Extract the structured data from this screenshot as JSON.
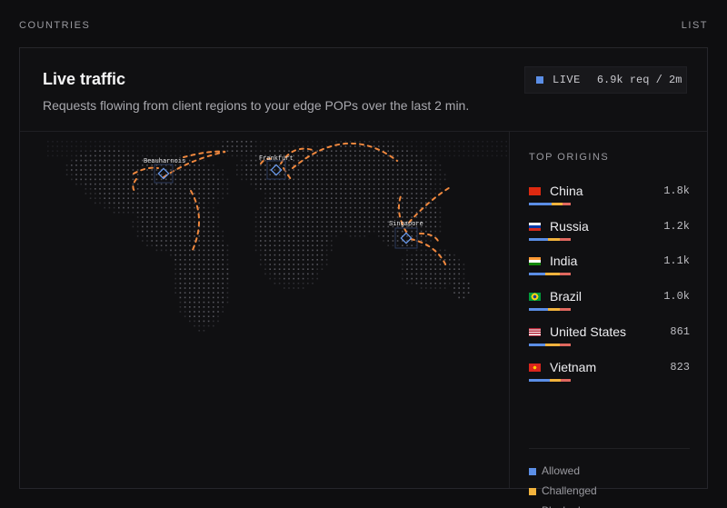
{
  "tabs": {
    "countries": "COUNTRIES",
    "list": "LIST"
  },
  "header": {
    "title": "Live traffic",
    "subtitle": "Requests flowing from client regions to your edge POPs over the last 2 min."
  },
  "live_badge": {
    "label": "LIVE",
    "rate": "6.9k req / 2m",
    "dot_color": "#5b8ee6"
  },
  "map": {
    "pops": [
      {
        "name": "Beauharnois",
        "icon": "diamond-icon"
      },
      {
        "name": "Frankfurt",
        "icon": "diamond-icon"
      },
      {
        "name": "Singapore",
        "icon": "diamond-icon"
      }
    ],
    "arc_color": "#f0883e"
  },
  "origins": {
    "title": "TOP ORIGINS",
    "items": [
      {
        "name": "China",
        "count": "1.8k",
        "flag": "flag-cn-icon",
        "mix": [
          0.55,
          0.25,
          0.2
        ]
      },
      {
        "name": "Russia",
        "count": "1.2k",
        "flag": "flag-ru-icon",
        "mix": [
          0.45,
          0.3,
          0.25
        ]
      },
      {
        "name": "India",
        "count": "1.1k",
        "flag": "flag-in-icon",
        "mix": [
          0.4,
          0.35,
          0.25
        ]
      },
      {
        "name": "Brazil",
        "count": "1.0k",
        "flag": "flag-br-icon",
        "mix": [
          0.45,
          0.3,
          0.25
        ]
      },
      {
        "name": "United States",
        "count": "861",
        "flag": "flag-us-icon",
        "mix": [
          0.4,
          0.35,
          0.25
        ]
      },
      {
        "name": "Vietnam",
        "count": "823",
        "flag": "flag-vn-icon",
        "mix": [
          0.5,
          0.25,
          0.25
        ]
      }
    ]
  },
  "legend": [
    {
      "label": "Allowed",
      "color": "#5b8ee6"
    },
    {
      "label": "Challenged",
      "color": "#f2b33d"
    },
    {
      "label": "Blocked",
      "color": "#e0685f"
    }
  ]
}
